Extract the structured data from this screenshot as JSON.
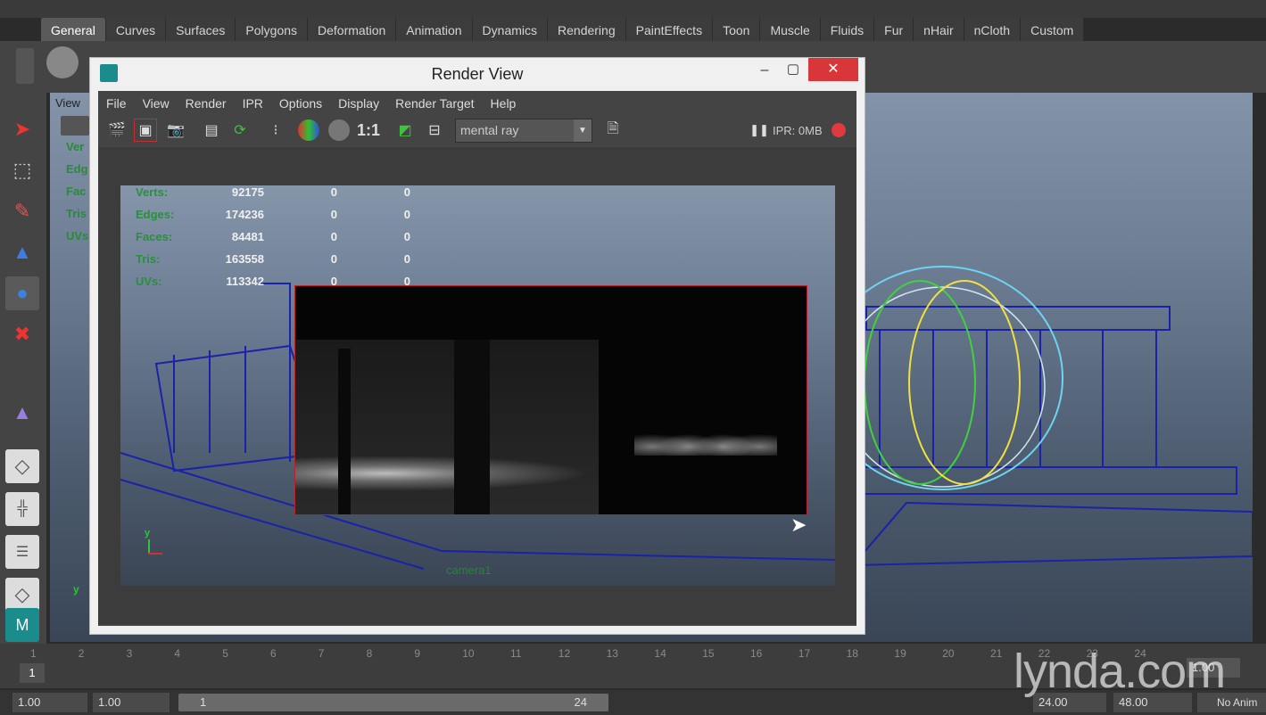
{
  "shelf_tabs": [
    "General",
    "Curves",
    "Surfaces",
    "Polygons",
    "Deformation",
    "Animation",
    "Dynamics",
    "Rendering",
    "PaintEffects",
    "Toon",
    "Muscle",
    "Fluids",
    "Fur",
    "nHair",
    "nCloth",
    "Custom"
  ],
  "viewport": {
    "menu_first": "View",
    "stats_labels_cropped": [
      "Ver",
      "Edg",
      "Fac",
      "Tris",
      "UVs"
    ],
    "axis_y": "y"
  },
  "render_view": {
    "title": "Render View",
    "menus": [
      "File",
      "View",
      "Render",
      "IPR",
      "Options",
      "Display",
      "Render Target",
      "Help"
    ],
    "ratio_label": "1:1",
    "renderer": "mental ray",
    "ipr_status": "IPR: 0MB",
    "stats": {
      "labels": [
        "Verts:",
        "Edges:",
        "Faces:",
        "Tris:",
        "UVs:"
      ],
      "col1": [
        "92175",
        "174236",
        "84481",
        "163558",
        "113342"
      ],
      "col2": [
        "0",
        "0",
        "0",
        "0",
        "0"
      ],
      "col3": [
        "0",
        "0",
        "0",
        "0",
        "0"
      ]
    },
    "camera_label": "camera1",
    "axis_y": "y"
  },
  "timeline": {
    "ticks": [
      "1",
      "2",
      "3",
      "4",
      "5",
      "6",
      "7",
      "8",
      "9",
      "10",
      "11",
      "12",
      "13",
      "14",
      "15",
      "16",
      "17",
      "18",
      "19",
      "20",
      "21",
      "22",
      "23",
      "24"
    ],
    "current_frame": "1",
    "current_time_field": "1.00"
  },
  "range_bar": {
    "start_time": "1.00",
    "playback_start": "1.00",
    "range_start": "1",
    "range_end": "24",
    "playback_end": "24.00",
    "end_time": "48.00",
    "anim_layer": "No Anim"
  },
  "watermark": "lynda.com",
  "colors": {
    "accent_red": "#c0202a",
    "stat_green": "#2a8f3c",
    "close_red": "#e0393e"
  }
}
